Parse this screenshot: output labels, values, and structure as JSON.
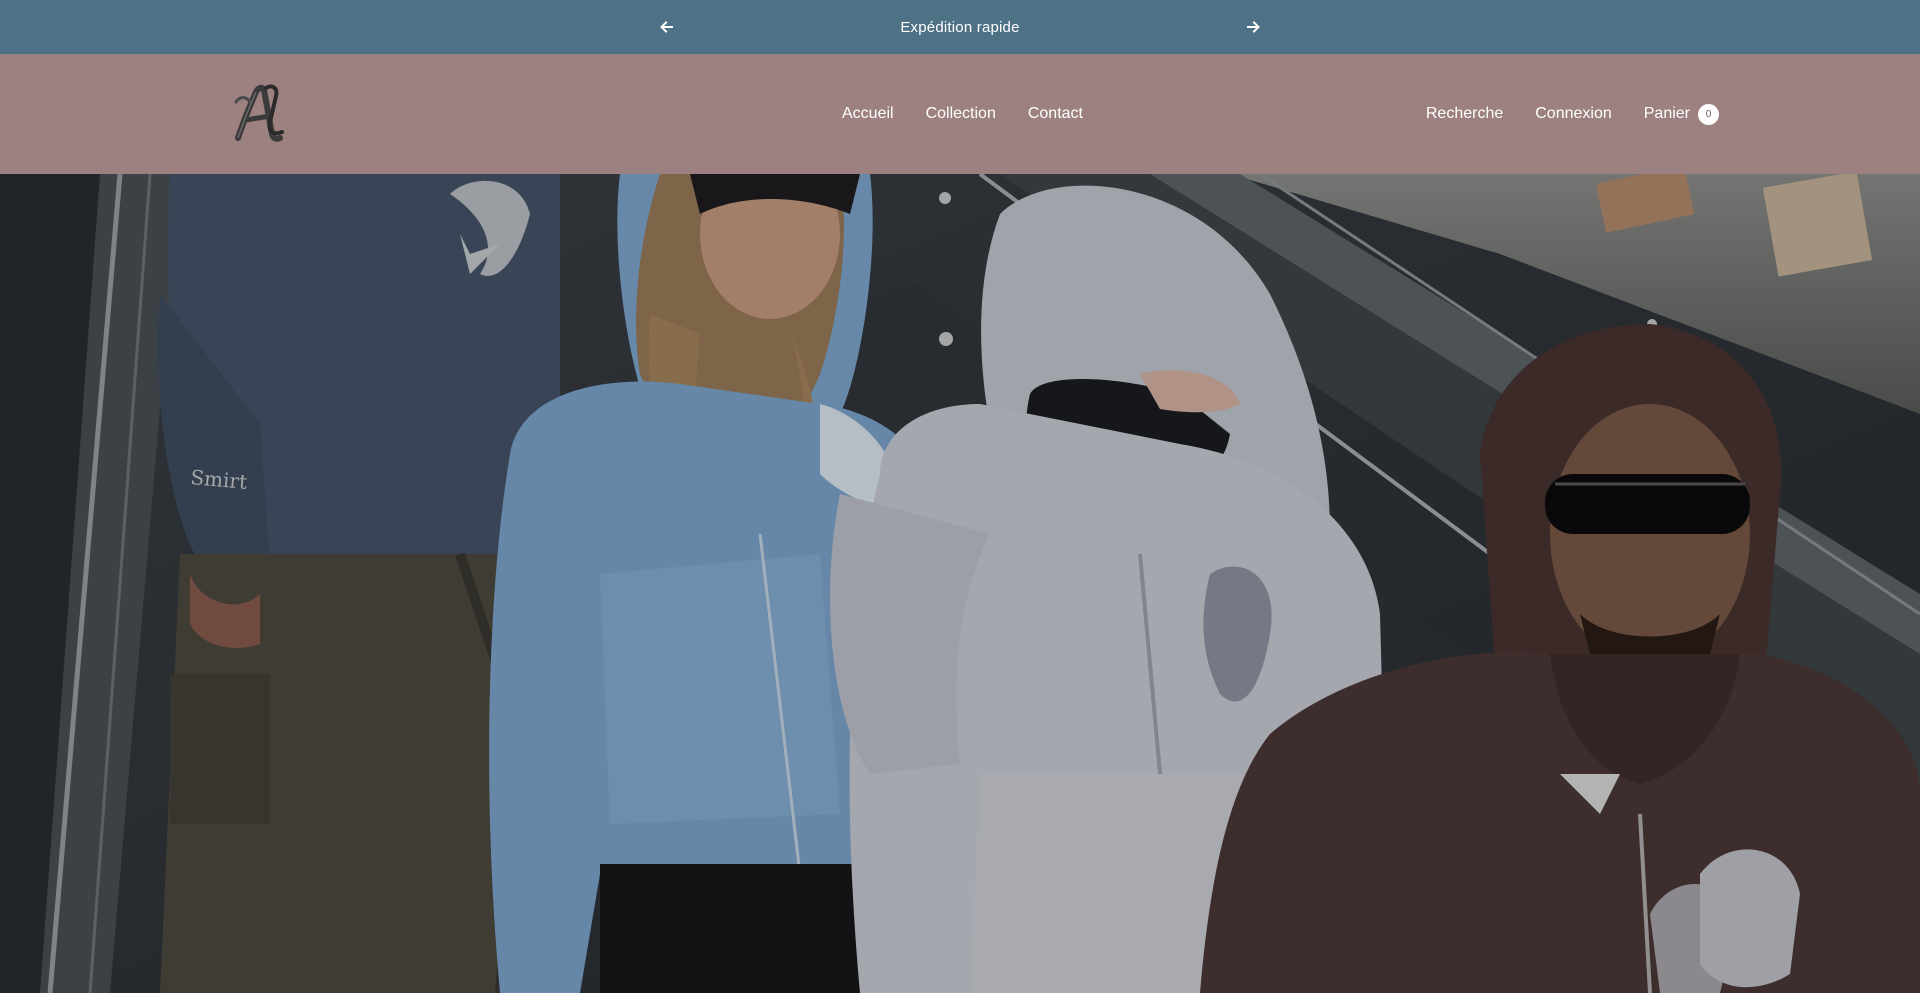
{
  "announcement": {
    "text": "Expédition rapide",
    "prev_icon": "arrow-left-icon",
    "next_icon": "arrow-right-icon"
  },
  "header": {
    "logo_icon": "brand-logo-icon",
    "nav": [
      {
        "label": "Accueil"
      },
      {
        "label": "Collection"
      },
      {
        "label": "Contact"
      }
    ],
    "search_label": "Recherche",
    "login_label": "Connexion",
    "cart_label": "Panier",
    "cart_count": "0"
  },
  "colors": {
    "announcement_bg": "#4f7185",
    "header_bg": "#9d8180",
    "text": "#ffffff"
  },
  "hero": {
    "image": "hero-photo-people-on-escalator"
  }
}
